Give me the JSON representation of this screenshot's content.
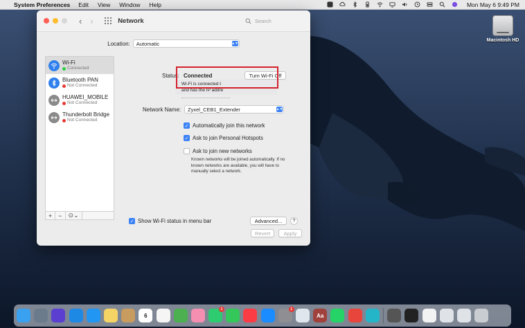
{
  "menubar": {
    "app_name": "System Preferences",
    "menus": [
      "Edit",
      "View",
      "Window",
      "Help"
    ],
    "clock": "Mon May 6  9:49 PM"
  },
  "window": {
    "title": "Network",
    "search_placeholder": "Search",
    "location_label": "Location:",
    "location_value": "Automatic"
  },
  "sidebar": {
    "services": [
      {
        "name": "Wi-Fi",
        "status": "Connected",
        "status_color": "#2ecc40",
        "icon": "wifi-icon",
        "icon_color": "#2f80ed",
        "selected": true
      },
      {
        "name": "Bluetooth PAN",
        "status": "Not Connected",
        "status_color": "#e53935",
        "icon": "bluetooth-icon",
        "icon_color": "#2f80ed",
        "selected": false
      },
      {
        "name": "HUAWEI_MOBILE",
        "status": "Not Connected",
        "status_color": "#e53935",
        "icon": "ethernet-arrows-icon",
        "icon_color": "#8a8a8a",
        "selected": false
      },
      {
        "name": "Thunderbolt Bridge",
        "status": "Not Connected",
        "status_color": "#e53935",
        "icon": "ethernet-arrows-icon",
        "icon_color": "#8a8a8a",
        "selected": false
      }
    ],
    "tools": {
      "add": "+",
      "remove": "−",
      "action": "⊙⌄"
    }
  },
  "detail": {
    "status_label": "Status:",
    "status_value": "Connected",
    "turn_off_label": "Turn Wi-Fi Off",
    "info_line1": "Wi-Fi is connected t",
    "info_line2": "and has the IP addre",
    "network_name_label": "Network Name:",
    "network_name_value": "Zyxel_CEB1_Extender",
    "auto_join_label": "Automatically join this network",
    "hotspots_label": "Ask to join Personal Hotspots",
    "new_networks_label": "Ask to join new networks",
    "help_text": "Known networks will be joined automatically. If no known networks are available, you will have to manually select a network.",
    "show_status_label": "Show Wi-Fi status in menu bar",
    "advanced_label": "Advanced...",
    "help_label": "?",
    "revert_label": "Revert",
    "apply_label": "Apply"
  },
  "desktop": {
    "hd_label": "Macintosh HD"
  },
  "dock": {
    "apps": [
      {
        "name": "finder",
        "color": "#3aa0f0"
      },
      {
        "name": "launchpad",
        "color": "#6b7b8c"
      },
      {
        "name": "siri",
        "color": "#5a3fd1"
      },
      {
        "name": "safari",
        "color": "#1e88e5"
      },
      {
        "name": "mail",
        "color": "#2196f3"
      },
      {
        "name": "notes",
        "color": "#f6d365"
      },
      {
        "name": "contacts",
        "color": "#c89b5e"
      },
      {
        "name": "calendar",
        "color": "#ffffff",
        "text": "6"
      },
      {
        "name": "reminders",
        "color": "#f5f5f5"
      },
      {
        "name": "maps",
        "color": "#4caf50"
      },
      {
        "name": "photos",
        "color": "#f48fb1"
      },
      {
        "name": "facetime",
        "color": "#2ecc71",
        "badge": "1"
      },
      {
        "name": "messages",
        "color": "#34c759"
      },
      {
        "name": "music",
        "color": "#fc3c44"
      },
      {
        "name": "app-store",
        "color": "#1a8cff"
      },
      {
        "name": "system-preferences",
        "color": "#8e8e93",
        "badge": "1"
      },
      {
        "name": "preview",
        "color": "#dfe6ee"
      },
      {
        "name": "dictionary",
        "color": "#a0413c",
        "text": "Aa"
      },
      {
        "name": "whatsapp",
        "color": "#25d366"
      },
      {
        "name": "chrome",
        "color": "#e8453c"
      },
      {
        "name": "mk-app",
        "color": "#24b5c8"
      },
      {
        "name": "calculator",
        "color": "#555555"
      },
      {
        "name": "activity-monitor",
        "color": "#222222"
      },
      {
        "name": "textedit",
        "color": "#f2f2f2"
      },
      {
        "name": "downloads-folder",
        "color": "#dfe3e8"
      },
      {
        "name": "documents-folder",
        "color": "#dfe3e8"
      },
      {
        "name": "trash",
        "color": "#c9ccd1"
      }
    ]
  }
}
